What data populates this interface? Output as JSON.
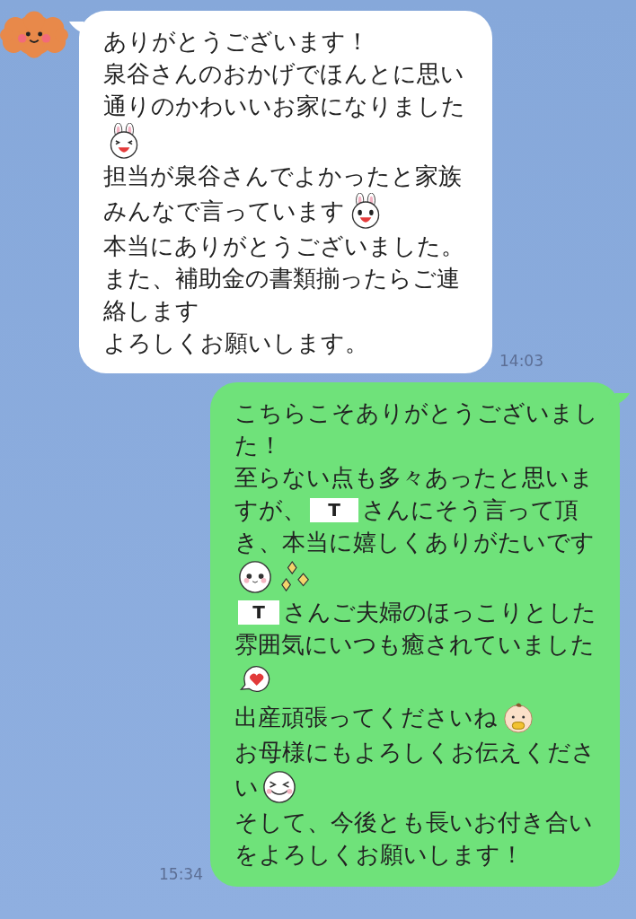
{
  "messages": [
    {
      "kind": "incoming",
      "time": "14:03",
      "lines": [
        [
          {
            "kind": "text",
            "text": "ありがとうございます！"
          }
        ],
        [
          {
            "kind": "text",
            "text": "泉谷さんのおかげでほんとに思い"
          }
        ],
        [
          {
            "kind": "text",
            "text": "通りのかわいいお家になりました"
          }
        ],
        [
          {
            "kind": "bunny"
          }
        ],
        [
          {
            "kind": "text",
            "text": "担当が泉谷さんでよかったと家族"
          }
        ],
        [
          {
            "kind": "text",
            "text": "みんなで言っています"
          },
          {
            "kind": "bunny2"
          }
        ],
        [
          {
            "kind": "text",
            "text": "本当にありがとうございました。"
          }
        ],
        [
          {
            "kind": "text",
            "text": "また、補助金の書類揃ったらご連"
          }
        ],
        [
          {
            "kind": "text",
            "text": "絡します"
          }
        ],
        [
          {
            "kind": "text",
            "text": "よろしくお願いします。"
          }
        ]
      ]
    },
    {
      "kind": "outgoing",
      "time": "15:34",
      "lines": [
        [
          {
            "kind": "text",
            "text": "こちらこそありがとうございまし"
          }
        ],
        [
          {
            "kind": "text",
            "text": "た！"
          }
        ],
        [
          {
            "kind": "text",
            "text": "至らない点も多々あったと思いま"
          }
        ],
        [
          {
            "kind": "text",
            "text": "すが、"
          },
          {
            "kind": "mask",
            "text": "T"
          },
          {
            "kind": "text",
            "text": "さんにそう言って頂"
          }
        ],
        [
          {
            "kind": "text",
            "text": "き、本当に嬉しくありがたいです"
          }
        ],
        [
          {
            "kind": "face"
          },
          {
            "kind": "sparkle"
          }
        ],
        [
          {
            "kind": "mask",
            "text": "T"
          },
          {
            "kind": "text",
            "text": "さんご夫婦のほっこりとした"
          }
        ],
        [
          {
            "kind": "text",
            "text": "雰囲気にいつも癒されていました"
          }
        ],
        [
          {
            "kind": "heart"
          }
        ],
        [
          {
            "kind": "text",
            "text": "出産頑張ってくださいね"
          },
          {
            "kind": "baby"
          }
        ],
        [
          {
            "kind": "text",
            "text": "お母様にもよろしくお伝えくださ"
          }
        ],
        [
          {
            "kind": "text",
            "text": "い"
          },
          {
            "kind": "grin"
          }
        ],
        [
          {
            "kind": "text",
            "text": "そして、今後とも長いお付き合い"
          }
        ],
        [
          {
            "kind": "text",
            "text": "をよろしくお願いします！"
          }
        ]
      ]
    }
  ]
}
